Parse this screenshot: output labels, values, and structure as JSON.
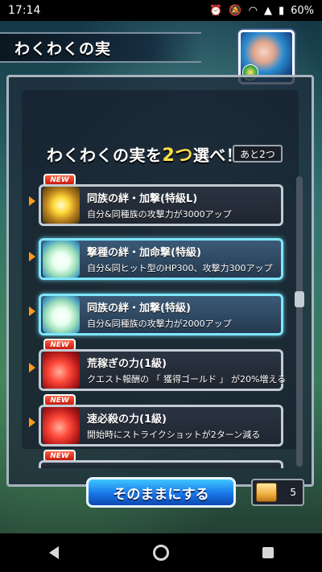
{
  "status": {
    "time": "17:14",
    "battery": "60%"
  },
  "screen": {
    "title": "わくわくの実"
  },
  "selection": {
    "heading_prefix": "わくわくの実を",
    "heading_count": "2つ",
    "heading_suffix": "選べ！",
    "remaining": "あと2つ"
  },
  "items": [
    {
      "new": true,
      "name": "同族の絆・加撃(特級L)",
      "desc": "自分&同種族の攻撃力が3000アップ",
      "icon": "gold-fruit-icon"
    },
    {
      "new": false,
      "name": "撃種の絆・加命撃(特級)",
      "desc": "自分&同ヒット型のHP300、攻撃力300アップ",
      "icon": "lotus-fruit-icon"
    },
    {
      "new": false,
      "name": "同族の絆・加撃(特級)",
      "desc": "自分&同種族の攻撃力が2000アップ",
      "icon": "lotus-fruit-icon"
    },
    {
      "new": true,
      "name": "荒稼ぎの力(1級)",
      "desc": "クエスト報酬の 「 獲得ゴールド 」 が20%増える",
      "icon": "red-fruit-icon"
    },
    {
      "new": true,
      "name": "速必殺の力(1級)",
      "desc": "開始時にストライクショットが2ターン減る",
      "icon": "red-fruit-icon"
    }
  ],
  "new_label": "NEW",
  "actions": {
    "keep_label": "そのままにする",
    "scroll_count": "5"
  }
}
